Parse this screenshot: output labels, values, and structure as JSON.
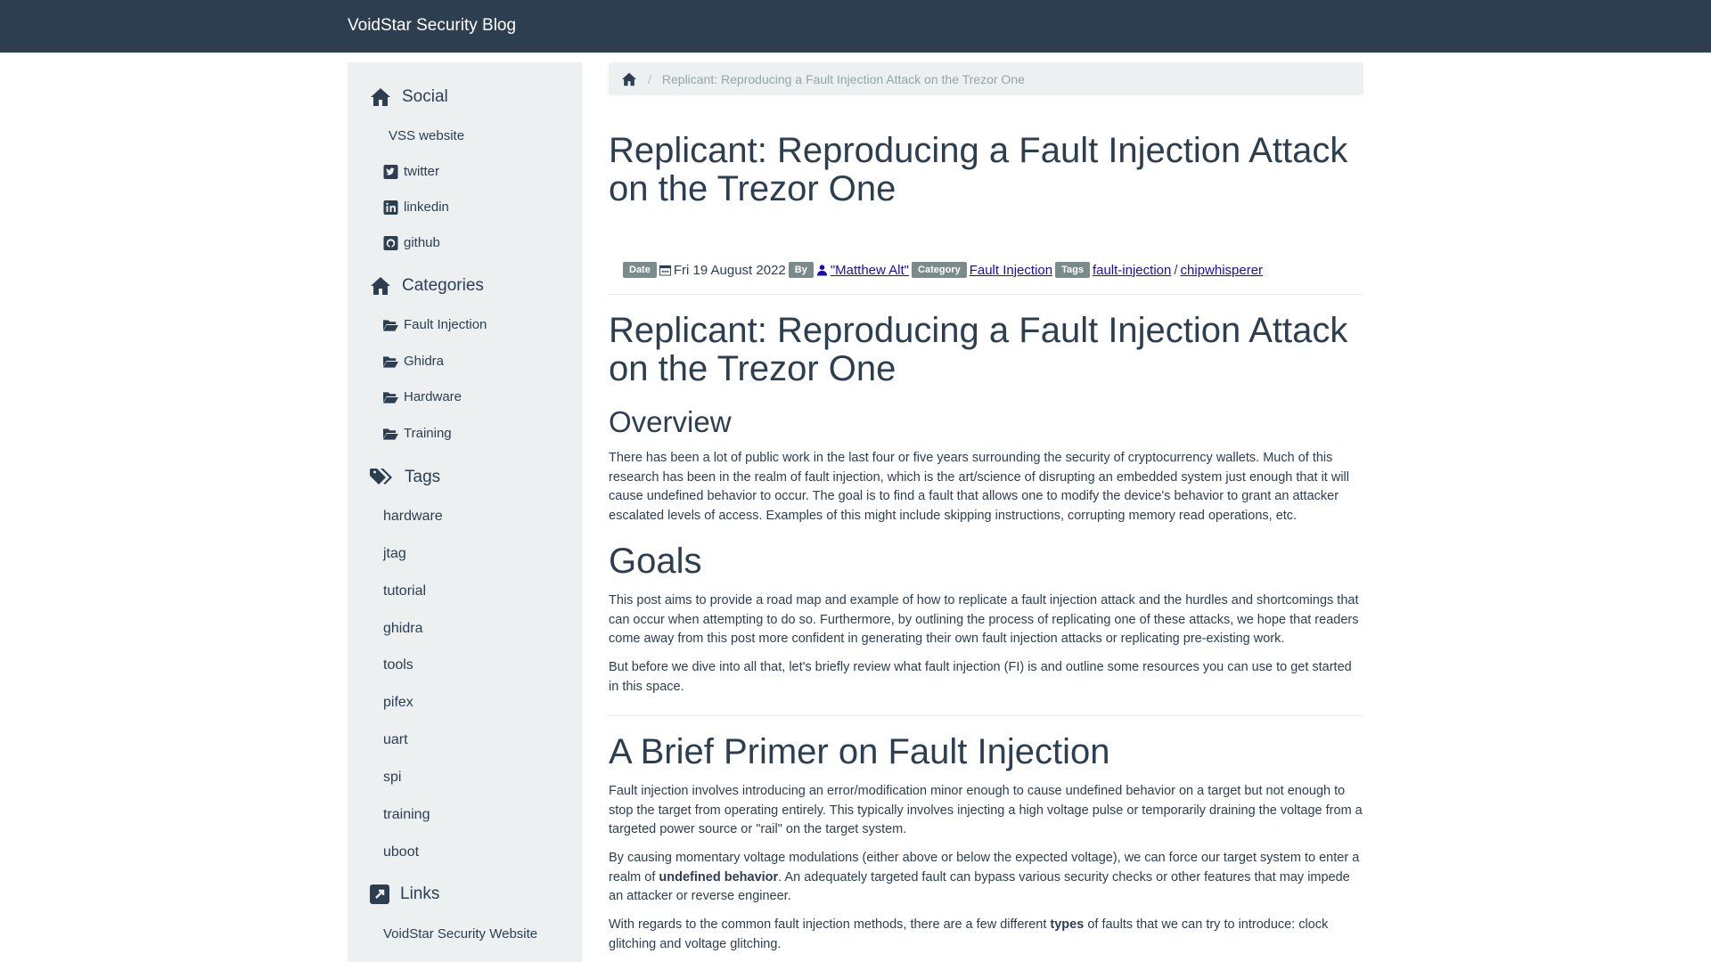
{
  "header": {
    "brand": "VoidStar Security Blog"
  },
  "sidebar": {
    "social": {
      "title": "Social",
      "items": [
        {
          "label": "VSS website",
          "icon": ""
        },
        {
          "label": "twitter",
          "icon": "twitter-icon"
        },
        {
          "label": "linkedin",
          "icon": "linkedin-icon"
        },
        {
          "label": "github",
          "icon": "github-icon"
        }
      ]
    },
    "categories": {
      "title": "Categories",
      "items": [
        "Fault Injection",
        "Ghidra",
        "Hardware",
        "Training"
      ]
    },
    "tags": {
      "title": "Tags",
      "items": [
        "hardware",
        "jtag",
        "tutorial",
        "ghidra",
        "tools",
        "pifex",
        "uart",
        "spi",
        "training",
        "uboot"
      ]
    },
    "links": {
      "title": "Links",
      "items": [
        "VoidStar Security Website"
      ]
    }
  },
  "breadcrumb": {
    "current": "Replicant: Reproducing a Fault Injection Attack on the Trezor One"
  },
  "article": {
    "title": "Replicant: Reproducing a Fault Injection Attack on the Trezor One",
    "meta": {
      "date_label": "Date",
      "date": "Fri 19 August 2022",
      "by_label": "By",
      "author": "\"Matthew Alt\"",
      "category_label": "Category",
      "category": "Fault Injection",
      "tags_label": "Tags",
      "tags": [
        "fault-injection",
        "chipwhisperer"
      ],
      "tag_separator": "/"
    },
    "heading": "Replicant: Reproducing a Fault Injection Attack on the Trezor One",
    "overview": {
      "title": "Overview",
      "text": "There has been a lot of public work in the last four or five years surrounding the security of cryptocurrency wallets. Much of this research has been in the realm of fault injection, which is the art/science of disrupting an embedded system just enough that it will cause undefined behavior to occur. The goal is to find a fault that allows one to modify the device's behavior to grant an attacker escalated levels of access. Examples of this might include skipping instructions, corrupting memory read operations, etc."
    },
    "goals": {
      "title": "Goals",
      "p1": "This post aims to provide a road map and example of how to replicate a fault injection attack and the hurdles and shortcomings that can occur when attempting to do so. Furthermore, by outlining the process of replicating one of these attacks, we hope that readers come away from this post more confident in generating their own fault injection attacks or replicating pre-existing work.",
      "p2": "But before we dive into all that, let's briefly review what fault injection (FI) is and outline some resources you can use to get started in this space."
    },
    "primer": {
      "title": "A Brief Primer on Fault Injection",
      "p1": "Fault injection involves introducing an error/modification minor enough to cause undefined behavior on a target but not enough to stop the target from operating entirely. This typically involves injecting a high voltage pulse or temporarily draining the voltage from a targeted power source or \"rail\" on the target system.",
      "p2_a": "By causing momentary voltage modulations (either above or below the expected voltage), we can force our target system to enter a realm of ",
      "p2_b": "undefined behavior",
      "p2_c": ". An adequately targeted fault can bypass various security checks or other features that may impede an attacker or reverse engineer.",
      "p3_a": "With regards to the common fault injection methods, there are a few different ",
      "p3_b": "types",
      "p3_c": " of faults that we can try to introduce: clock glitching and voltage glitching."
    }
  }
}
